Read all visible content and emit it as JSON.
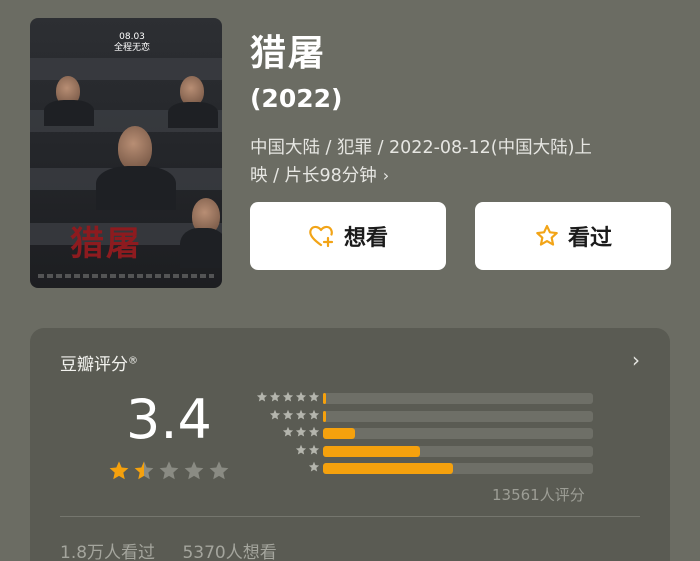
{
  "poster": {
    "date_text": "08.03",
    "release_text": "全程无恋",
    "red_title": "猎屠"
  },
  "movie": {
    "title": "猎屠",
    "year": "(2022)",
    "meta_line1": "中国大陆 / 犯罪 / 2022-08-12(中国大陆)上",
    "meta_line2": "映 / 片长98分钟",
    "meta_chevron": "›"
  },
  "actions": {
    "want_label": "想看",
    "seen_label": "看过"
  },
  "rating": {
    "header": "豆瓣评分",
    "header_mark": "®",
    "score": "3.4",
    "stars_filled": 1.5,
    "distribution_percent": {
      "five": 1,
      "four": 1,
      "three": 12,
      "two": 36,
      "one": 48
    },
    "count_text": "13561人评分",
    "seen_text": "1.8万人看过",
    "want_text": "5370人想看"
  },
  "colors": {
    "background": "#6b6c63",
    "card": "#5a5b53",
    "accent": "#f5a10d",
    "track": "#6e6f67"
  }
}
